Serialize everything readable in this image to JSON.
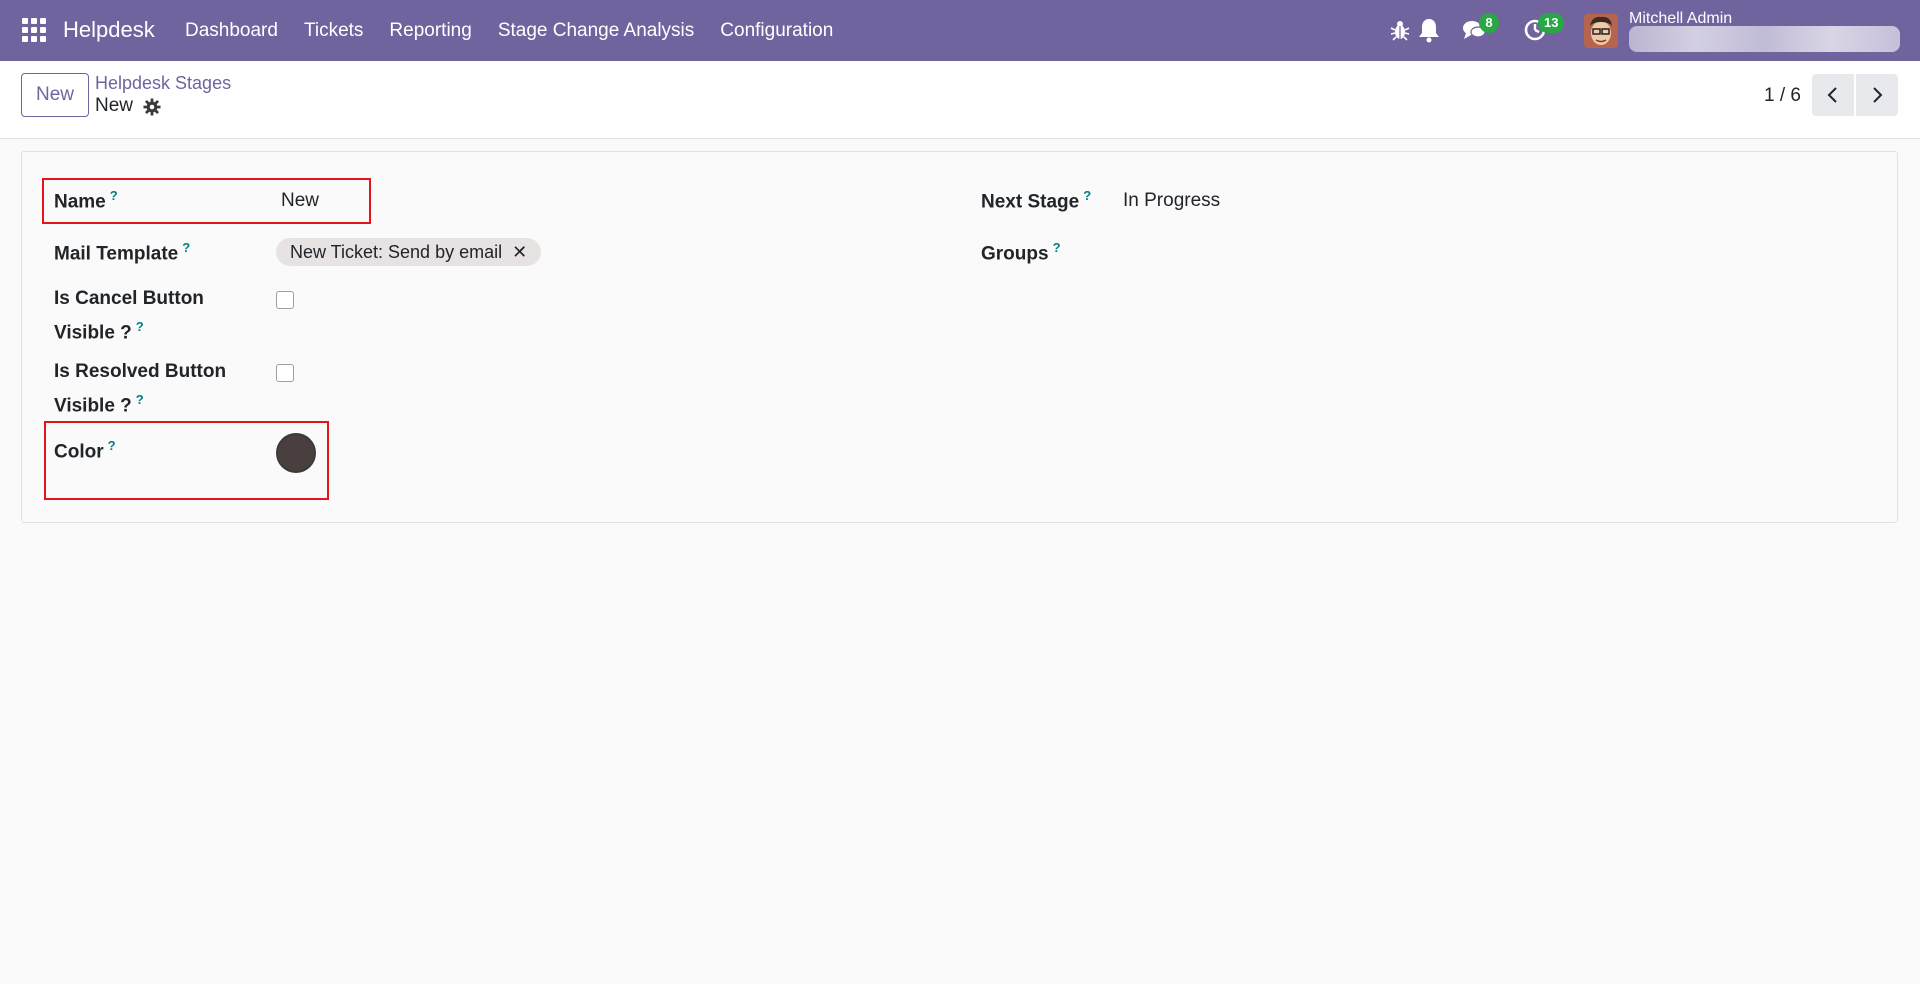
{
  "nav": {
    "brand": "Helpdesk",
    "menu": [
      "Dashboard",
      "Tickets",
      "Reporting",
      "Stage Change Analysis",
      "Configuration"
    ],
    "chat_count": "8",
    "activity_count": "13",
    "user_name": "Mitchell Admin",
    "icons": [
      "apps-icon",
      "bug-icon",
      "bell-icon",
      "chat-icon",
      "clock-icon"
    ]
  },
  "control": {
    "new_label": "New",
    "breadcrumb": "Helpdesk Stages",
    "record_name": "New",
    "pager": "1 / 6"
  },
  "form": {
    "name_label": "Name",
    "name_value": "New",
    "mail_template_label": "Mail Template",
    "mail_template_tag": "New Ticket: Send by email",
    "cancel_label_line1": "Is Cancel Button",
    "cancel_label_line2": "Visible ?",
    "cancel_checked": false,
    "resolved_label_line1": "Is Resolved Button",
    "resolved_label_line2": "Visible ?",
    "resolved_checked": false,
    "color_label": "Color",
    "color_value": "#4a3f3f",
    "next_stage_label": "Next Stage",
    "next_stage_value": "In Progress",
    "groups_label": "Groups",
    "help_mark": "?"
  },
  "colors": {
    "navbar": "#71639e",
    "accent": "#71639e",
    "badge": "#28a745",
    "help": "#017e84",
    "highlight": "#e5141a"
  }
}
